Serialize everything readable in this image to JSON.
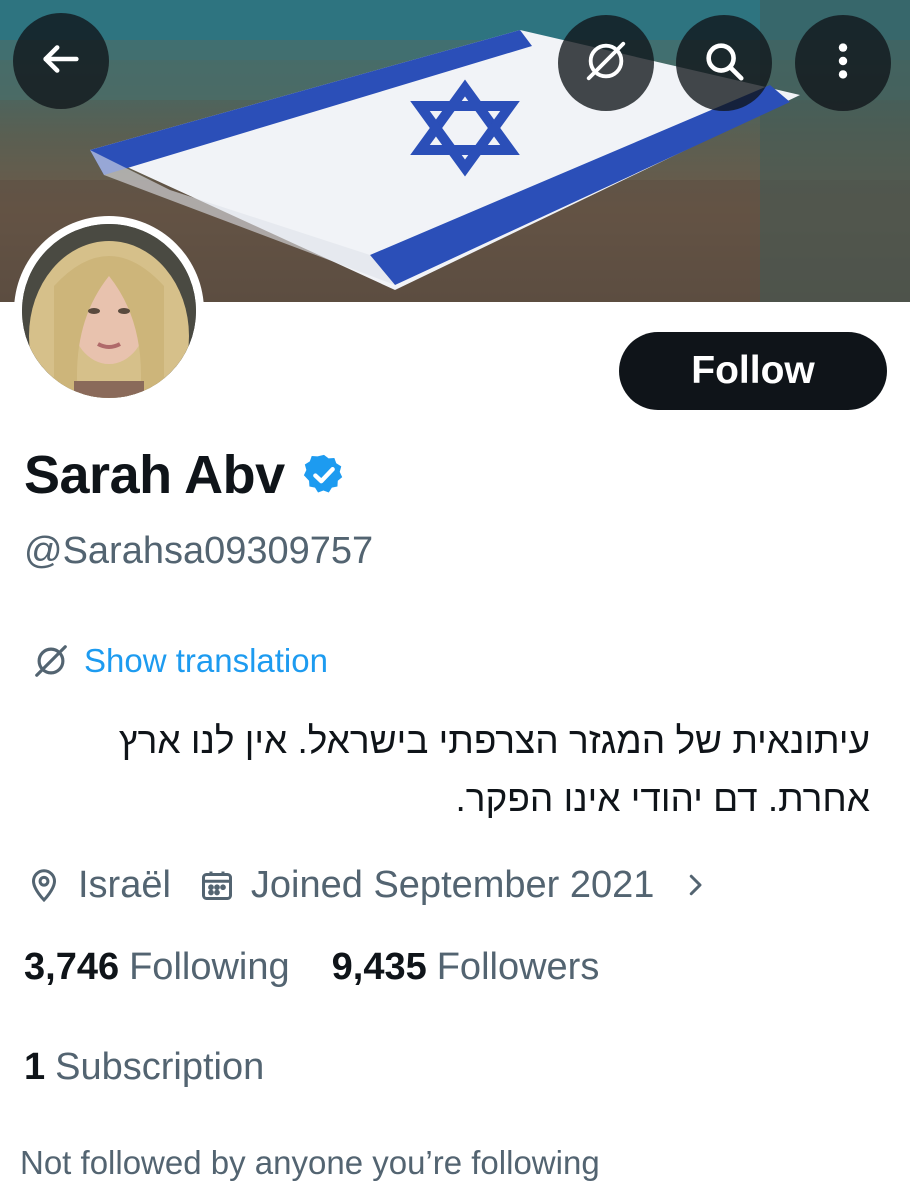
{
  "header": {
    "back_icon": "arrow-left-icon",
    "translate_icon": "translate-globe-icon",
    "search_icon": "search-icon",
    "more_icon": "more-vertical-icon"
  },
  "profile": {
    "banner_description": "israeli-flag-banner",
    "display_name": "Sarah Abv",
    "verified": true,
    "handle": "@Sarahsa09309757",
    "follow_label": "Follow",
    "show_translation_label": "Show translation",
    "bio_lines": [
      "עיתונאית של המגזר הצרפתי בישראל.  אין לנו ארץ",
      "אחרת. דם יהודי אינו הפקר."
    ],
    "location": "Israël",
    "joined": "Joined September 2021",
    "following_count": "3,746",
    "following_label": "Following",
    "followers_count": "9,435",
    "followers_label": "Followers",
    "subscription_count": "1",
    "subscription_label": "Subscription",
    "followed_by_note": "Not followed by anyone you’re following"
  },
  "colors": {
    "accent": "#1d9bf0",
    "text_primary": "#0f1419",
    "text_secondary": "#536471",
    "button_dark": "#0f1419",
    "flag_blue": "#2b4fb8"
  }
}
